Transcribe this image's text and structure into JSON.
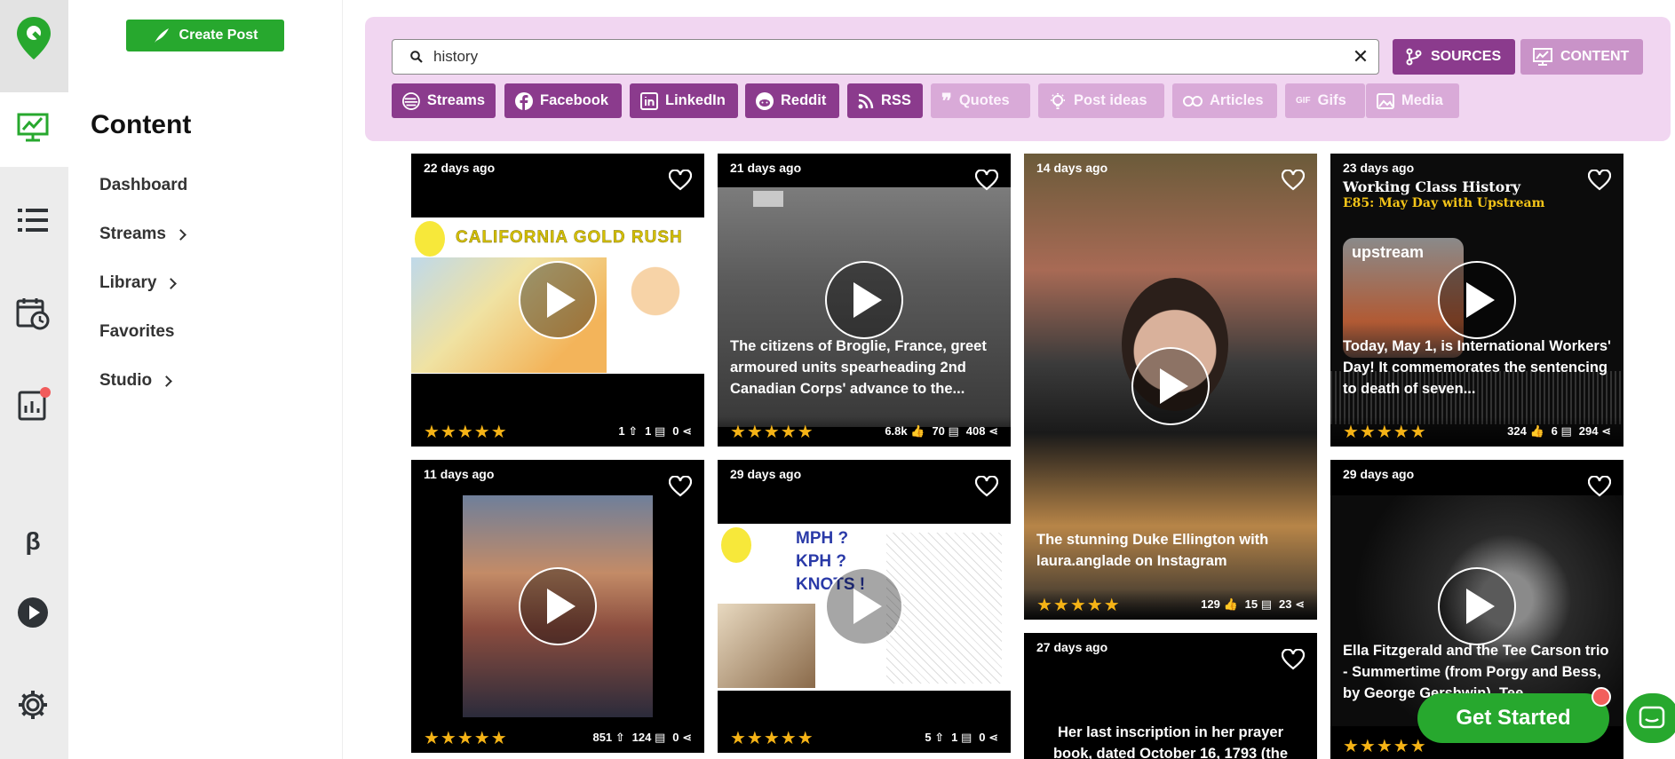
{
  "rail": {
    "icons": [
      "logo-pin-icon",
      "content-chart-icon",
      "list-icon",
      "calendar-clock-icon",
      "analytics-icon",
      "beta-icon",
      "play-icon",
      "gear-icon"
    ],
    "beta_label": "β"
  },
  "nav": {
    "create_label": "Create Post",
    "title": "Content",
    "items": [
      {
        "label": "Dashboard",
        "has_sub": false
      },
      {
        "label": "Streams",
        "has_sub": true
      },
      {
        "label": "Library",
        "has_sub": true
      },
      {
        "label": "Favorites",
        "has_sub": false
      },
      {
        "label": "Studio",
        "has_sub": true
      }
    ]
  },
  "search": {
    "value": "history",
    "placeholder": "",
    "sources_label": "SOURCES",
    "content_label": "CONTENT"
  },
  "chips": [
    {
      "label": "Streams",
      "active": true
    },
    {
      "label": "Facebook",
      "active": true
    },
    {
      "label": "LinkedIn",
      "active": true
    },
    {
      "label": "Reddit",
      "active": true
    },
    {
      "label": "RSS",
      "active": true
    },
    {
      "label": "Quotes",
      "active": false
    },
    {
      "label": "Post ideas",
      "active": false
    },
    {
      "label": "Articles",
      "active": false
    },
    {
      "label": "Gifs",
      "active": false
    },
    {
      "label": "Media",
      "active": false
    }
  ],
  "cards": [
    {
      "age": "22 days ago",
      "title_overlay": "CALIFORNIA GOLD RUSH",
      "caption": "",
      "stars": "★★★★★",
      "stats": [
        "1 ⇧",
        "1 ▤",
        "0 ⋖"
      ]
    },
    {
      "age": "21 days ago",
      "caption": "The citizens of Broglie, France, greet armoured units spearheading 2nd Canadian Corps' advance to the...",
      "stars": "★★★★★",
      "stats": [
        "6.8k 👍",
        "70 ▤",
        "408 ⋖"
      ]
    },
    {
      "age": "14 days ago",
      "caption": "The stunning Duke Ellington with laura.anglade on Instagram",
      "stars": "★★★★★",
      "stats": [
        "129 👍",
        "15 ▤",
        "23 ⋖"
      ]
    },
    {
      "age": "23 days ago",
      "overlay_title": "Working Class History",
      "overlay_sub": "E85: May Day with Upstream",
      "overlay_logo": "upstream",
      "caption": "Today, May 1, is International Workers' Day! It commemorates the sentencing to death of seven...",
      "stars": "★★★★★",
      "stats": [
        "324 👍",
        "6 ▤",
        "294 ⋖"
      ]
    },
    {
      "age": "11 days ago",
      "caption": "",
      "stars": "★★★★★",
      "stats": [
        "851 ⇧",
        "124 ▤",
        "0 ⋖"
      ]
    },
    {
      "age": "29 days ago",
      "overlay_lines": [
        "MPH ?",
        "KPH ?",
        "KNOTS !"
      ],
      "caption": "",
      "stars": "★★★★★",
      "stats": [
        "5 ⇧",
        "1 ▤",
        "0 ⋖"
      ]
    },
    {
      "age": "27 days ago",
      "caption": "Her last inscription in her prayer book, dated October 16, 1793 (the",
      "stars": "",
      "stats": []
    },
    {
      "age": "29 days ago",
      "caption": "Ella Fitzgerald and the Tee Carson trio - Summertime (from Porgy and Bess, by George Gershwin). Tee",
      "stars": "★★★★★",
      "stats": []
    }
  ],
  "cta": {
    "get_started": "Get Started"
  },
  "colors": {
    "brand_green": "#27a82e",
    "chip_purple": "#8b3b8d",
    "chip_disabled": "#d9aad8",
    "panel_pink": "#f1d6f1",
    "star": "#f5b316"
  }
}
